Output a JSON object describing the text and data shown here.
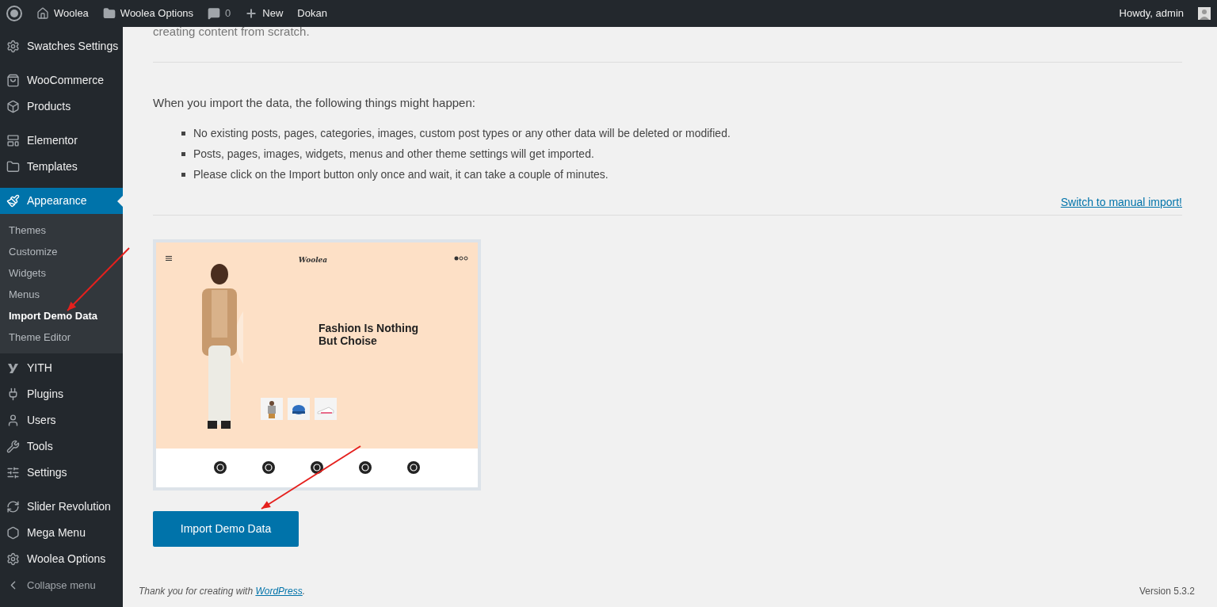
{
  "admin_bar": {
    "items": [
      {
        "kind": "logo"
      },
      {
        "kind": "home",
        "label": "Woolea"
      },
      {
        "kind": "folder",
        "label": "Woolea Options"
      },
      {
        "kind": "comments",
        "label": "0"
      },
      {
        "kind": "new",
        "label": "New"
      },
      {
        "kind": "text",
        "label": "Dokan"
      }
    ],
    "greeting": "Howdy, admin"
  },
  "sidebar": {
    "groups": [
      [
        {
          "kind": "menu",
          "label": "Swatches Settings",
          "selected": false
        }
      ],
      [
        {
          "kind": "menu",
          "label": "WooCommerce",
          "selected": false
        },
        {
          "kind": "menu",
          "label": "Products",
          "selected": false
        }
      ],
      [
        {
          "kind": "menu",
          "label": "Elementor",
          "selected": false
        },
        {
          "kind": "menu",
          "label": "Templates",
          "selected": false
        }
      ],
      [
        {
          "kind": "menu",
          "label": "Appearance",
          "selected": true,
          "children": [
            {
              "label": "Themes",
              "selected": false
            },
            {
              "label": "Customize",
              "selected": false
            },
            {
              "label": "Widgets",
              "selected": false
            },
            {
              "label": "Menus",
              "selected": false
            },
            {
              "label": "Import Demo Data",
              "selected": true
            },
            {
              "label": "Theme Editor",
              "selected": false
            }
          ]
        },
        {
          "kind": "menu",
          "label": "YITH",
          "selected": false
        },
        {
          "kind": "menu",
          "label": "Plugins",
          "selected": false
        },
        {
          "kind": "menu",
          "label": "Users",
          "selected": false
        },
        {
          "kind": "menu",
          "label": "Tools",
          "selected": false
        },
        {
          "kind": "menu",
          "label": "Settings",
          "selected": false
        }
      ],
      [
        {
          "kind": "menu",
          "label": "Slider Revolution",
          "selected": false
        },
        {
          "kind": "menu",
          "label": "Mega Menu",
          "selected": false
        },
        {
          "kind": "menu",
          "label": "Woolea Options",
          "selected": false
        },
        {
          "kind": "collapse",
          "label": "Collapse menu",
          "selected": false
        }
      ]
    ]
  },
  "content": {
    "cut_text": "creating content from scratch.",
    "intro": "When you import the data, the following things might happen:",
    "bullets": [
      "No existing posts, pages, categories, images, custom post types or any other data will be deleted or modified.",
      "Posts, pages, images, widgets, menus and other theme settings will get imported.",
      "Please click on the Import button only once and wait, it can take a couple of minutes."
    ],
    "manual_link": "Switch to manual import!",
    "preview": {
      "logo": "Woolea",
      "headline": [
        "Fashion Is Nothing",
        "But Choise"
      ]
    },
    "button": "Import Demo Data"
  },
  "footer": {
    "thanks": "Thank you for creating with ",
    "link": "WordPress",
    "after": ".",
    "version": "Version 5.3.2"
  }
}
